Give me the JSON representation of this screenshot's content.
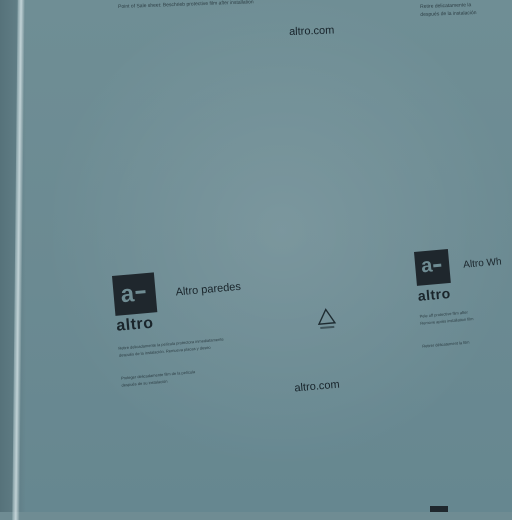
{
  "top_left": {
    "fine_text": "Point of Sale sheet: Beschrieb protective film after installation",
    "url": "altro.com"
  },
  "top_right": {
    "fine_text_1": "Retire delicatamente la",
    "fine_text_2": "después de la instalación"
  },
  "center": {
    "logo_word": "altro",
    "product": "Altro paredes",
    "fine_text_1": "Retire delicadamente la película protectora inmediatamente",
    "fine_text_2": "después de la instalación. Remueva placas y deseo",
    "fine_text_3": "Proteger delicadamente film de la película",
    "fine_text_4": "después de su instalación",
    "url": "altro.com"
  },
  "right": {
    "logo_word": "altro",
    "product": "Altro Wh",
    "fine_text_1": "Pele off protective film after",
    "fine_text_2": "Remove après installation film",
    "fine_text_3": "Retirer délicatement la film"
  }
}
